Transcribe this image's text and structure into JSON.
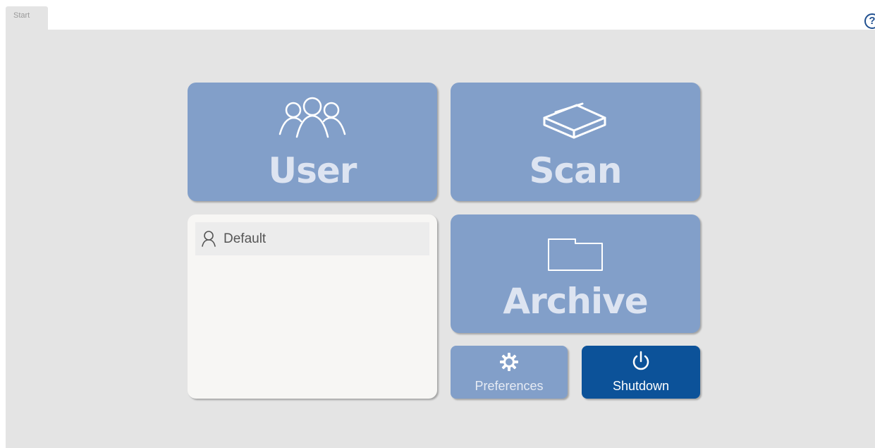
{
  "tabs": [
    {
      "label": "Start",
      "active": true
    }
  ],
  "help": {
    "icon": "help-icon",
    "glyph": "?"
  },
  "tiles": {
    "user": {
      "label": "User",
      "icon": "users-icon"
    },
    "scan": {
      "label": "Scan",
      "icon": "scanner-icon"
    },
    "archive": {
      "label": "Archive",
      "icon": "folder-icon"
    },
    "preferences": {
      "label": "Preferences",
      "icon": "gear-icon"
    },
    "shutdown": {
      "label": "Shutdown",
      "icon": "power-icon"
    }
  },
  "user_list": {
    "items": [
      {
        "label": "Default",
        "icon": "person-icon",
        "selected": true
      }
    ]
  },
  "colors": {
    "tile": "#829fc9",
    "tile_text": "#dde4f1",
    "shutdown": "#0c5299",
    "background": "#e4e4e4",
    "list_background": "#f7f6f4"
  }
}
